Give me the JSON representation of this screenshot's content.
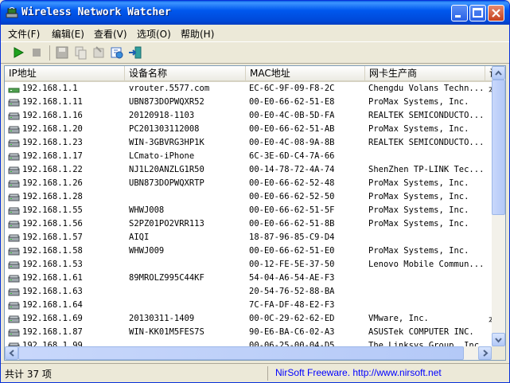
{
  "window": {
    "title": "Wireless Network Watcher"
  },
  "menu": [
    "文件(F)",
    "编辑(E)",
    "查看(V)",
    "选项(O)",
    "帮助(H)"
  ],
  "columns": [
    "IP地址",
    "设备名称",
    "MAC地址",
    "网卡生产商",
    "设"
  ],
  "rows": [
    {
      "ip": "192.168.1.1",
      "name": "vrouter.5577.com",
      "mac": "EC-6C-9F-09-F8-2C",
      "vendor": "Chengdu Volans Techn...",
      "extra": "本",
      "icon": "router"
    },
    {
      "ip": "192.168.1.11",
      "name": "UBN873DOPWQXR52",
      "mac": "00-E0-66-62-51-E8",
      "vendor": "ProMax Systems, Inc.",
      "extra": "",
      "icon": "pc"
    },
    {
      "ip": "192.168.1.16",
      "name": "20120918-1103",
      "mac": "00-E0-4C-0B-5D-FA",
      "vendor": "REALTEK SEMICONDUCTO...",
      "extra": "",
      "icon": "pc"
    },
    {
      "ip": "192.168.1.20",
      "name": "PC201303112008",
      "mac": "00-E0-66-62-51-AB",
      "vendor": "ProMax Systems, Inc.",
      "extra": "",
      "icon": "pc"
    },
    {
      "ip": "192.168.1.23",
      "name": "WIN-3GBVRG3HP1K",
      "mac": "00-E0-4C-08-9A-8B",
      "vendor": "REALTEK SEMICONDUCTO...",
      "extra": "",
      "icon": "pc"
    },
    {
      "ip": "192.168.1.17",
      "name": "LCmato-iPhone",
      "mac": "6C-3E-6D-C4-7A-66",
      "vendor": "",
      "extra": "",
      "icon": "pc"
    },
    {
      "ip": "192.168.1.22",
      "name": "NJ1L20ANZLG1R50",
      "mac": "00-14-78-72-4A-74",
      "vendor": "ShenZhen TP-LINK Tec...",
      "extra": "",
      "icon": "pc"
    },
    {
      "ip": "192.168.1.26",
      "name": "UBN873DOPWQXRTP",
      "mac": "00-E0-66-62-52-48",
      "vendor": "ProMax Systems, Inc.",
      "extra": "",
      "icon": "pc"
    },
    {
      "ip": "192.168.1.28",
      "name": "",
      "mac": "00-E0-66-62-52-50",
      "vendor": "ProMax Systems, Inc.",
      "extra": "",
      "icon": "pc"
    },
    {
      "ip": "192.168.1.55",
      "name": "WHWJ008",
      "mac": "00-E0-66-62-51-5F",
      "vendor": "ProMax Systems, Inc.",
      "extra": "",
      "icon": "pc"
    },
    {
      "ip": "192.168.1.56",
      "name": "S2PZ01PO2VRR113",
      "mac": "00-E0-66-62-51-8B",
      "vendor": "ProMax Systems, Inc.",
      "extra": "",
      "icon": "pc"
    },
    {
      "ip": "192.168.1.57",
      "name": "AIQI",
      "mac": "18-87-96-85-C9-D4",
      "vendor": "",
      "extra": "",
      "icon": "pc"
    },
    {
      "ip": "192.168.1.58",
      "name": "WHWJ009",
      "mac": "00-E0-66-62-51-E0",
      "vendor": "ProMax Systems, Inc.",
      "extra": "",
      "icon": "pc"
    },
    {
      "ip": "192.168.1.53",
      "name": "",
      "mac": "00-12-FE-5E-37-50",
      "vendor": "Lenovo Mobile Commun...",
      "extra": "",
      "icon": "pc"
    },
    {
      "ip": "192.168.1.61",
      "name": "89MROLZ995C44KF",
      "mac": "54-04-A6-54-AE-F3",
      "vendor": "",
      "extra": "",
      "icon": "pc"
    },
    {
      "ip": "192.168.1.63",
      "name": "",
      "mac": "20-54-76-52-88-BA",
      "vendor": "",
      "extra": "",
      "icon": "pc"
    },
    {
      "ip": "192.168.1.64",
      "name": "",
      "mac": "7C-FA-DF-48-E2-F3",
      "vendor": "",
      "extra": "",
      "icon": "pc"
    },
    {
      "ip": "192.168.1.69",
      "name": "20130311-1409",
      "mac": "00-0C-29-62-62-ED",
      "vendor": "VMware, Inc.",
      "extra": "本",
      "icon": "pc"
    },
    {
      "ip": "192.168.1.87",
      "name": "WIN-KK01M5FES7S",
      "mac": "90-E6-BA-C6-02-A3",
      "vendor": "ASUSTek COMPUTER INC.",
      "extra": "",
      "icon": "pc"
    },
    {
      "ip": "192.168.1.99",
      "name": "",
      "mac": "00-06-25-00-04-D5",
      "vendor": "The Linksys Group, Inc.",
      "extra": "",
      "icon": "pc"
    }
  ],
  "status": {
    "count": "共计 37 项",
    "link": "NirSoft Freeware.  http://www.nirsoft.net"
  }
}
